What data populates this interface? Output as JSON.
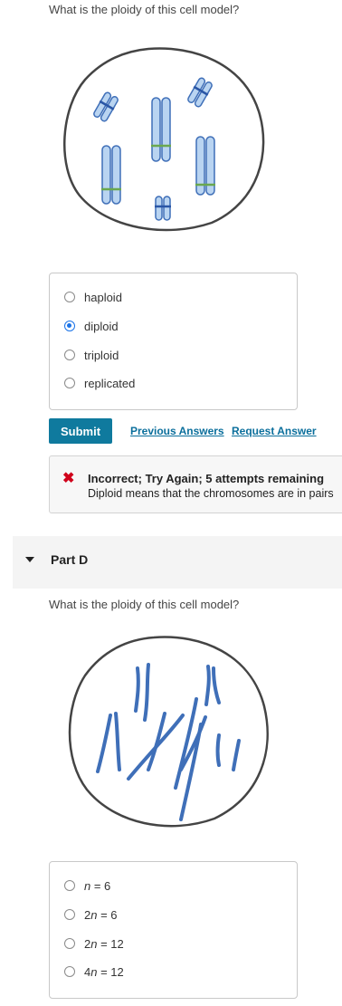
{
  "partC": {
    "question": "What is the ploidy of this cell model?",
    "options": [
      {
        "label": "haploid",
        "selected": false
      },
      {
        "label": "diploid",
        "selected": true
      },
      {
        "label": "triploid",
        "selected": false
      },
      {
        "label": "replicated",
        "selected": false
      }
    ],
    "submit_label": "Submit",
    "previous_answers_label": "Previous Answers",
    "request_answer_label": "Request Answer",
    "feedback": {
      "title": "Incorrect; Try Again; 5 attempts remaining",
      "text": "Diploid means that the chromosomes are in pairs"
    }
  },
  "partD": {
    "title": "Part D",
    "question": "What is the ploidy of this cell model?",
    "options": [
      {
        "var": "n",
        "rest": " = 6"
      },
      {
        "prefix": "2",
        "var": "n",
        "rest": " = 6"
      },
      {
        "prefix": "2",
        "var": "n",
        "rest": " = 12"
      },
      {
        "prefix": "4",
        "var": "n",
        "rest": " = 12"
      }
    ]
  },
  "colors": {
    "chromosome_fill": "#b9d4f1",
    "chromosome_stroke": "#3f6fb8",
    "band_blue": "#2a56a6",
    "band_green": "#6aa84f",
    "submit_bg": "#0f7a9e",
    "link": "#0b6f9c",
    "error_x": "#d0021b"
  }
}
